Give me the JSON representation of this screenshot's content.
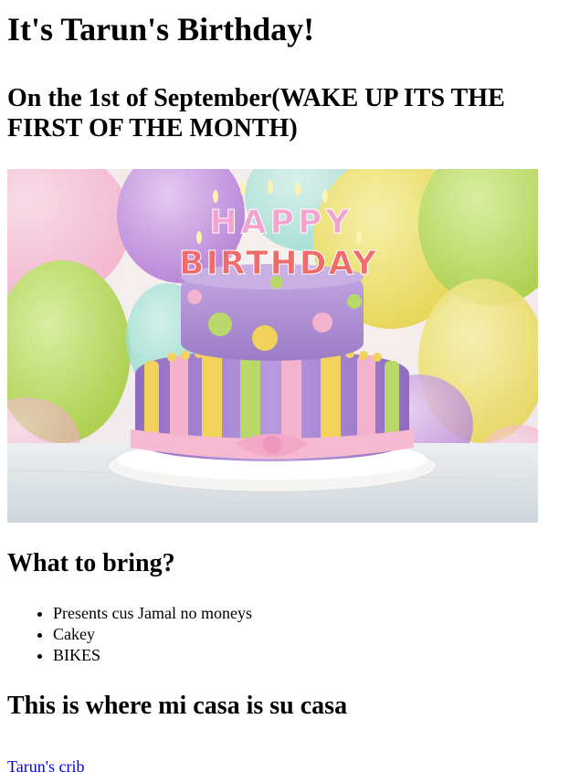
{
  "title": "It's Tarun's Birthday!",
  "subtitle": "On the 1st of September(WAKE UP ITS THE FIRST OF THE MONTH)",
  "hero": {
    "alt": "Birthday cake with Happy Birthday candles",
    "candle_top": "HAPPY",
    "candle_bottom": "BIRTHDAY",
    "colors": {
      "purple_fondant": "#b79ad6",
      "pink": "#f3b3cf",
      "yellow": "#f1d35c",
      "green": "#b9d86a"
    }
  },
  "bring": {
    "heading": "What to bring?",
    "items": [
      "Presents cus Jamal no moneys",
      "Cakey",
      "BIKES"
    ]
  },
  "casa": {
    "heading": "This is where mi casa is su casa",
    "link_text": "Tarun's crib"
  }
}
